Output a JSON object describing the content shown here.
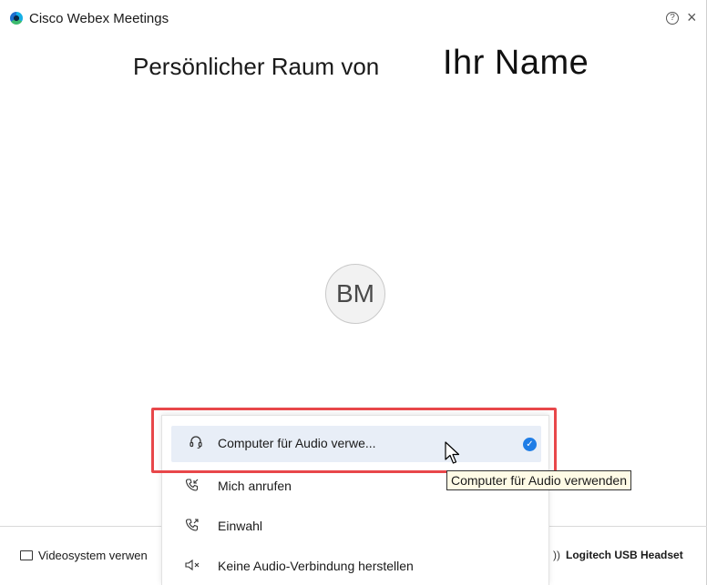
{
  "window": {
    "title": "Cisco Webex Meetings"
  },
  "room": {
    "label": "Persönlicher Raum von",
    "name": "Ihr Name"
  },
  "avatar": {
    "initials": "BM"
  },
  "audio_menu": {
    "items": [
      {
        "label": "Computer für Audio verwe...",
        "icon": "headset-icon",
        "selected": true
      },
      {
        "label": "Mich anrufen",
        "icon": "call-me-icon",
        "selected": false
      },
      {
        "label": "Einwahl",
        "icon": "dial-in-icon",
        "selected": false
      },
      {
        "label": "Keine Audio-Verbindung herstellen",
        "icon": "no-audio-icon",
        "selected": false
      }
    ]
  },
  "tooltip": {
    "text": "Computer für Audio verwenden"
  },
  "bottom_bar": {
    "video_system": "Videosystem verwen",
    "audio_device": "Logitech USB Headset"
  },
  "colors": {
    "accent": "#1f7de6",
    "selected_bg": "#e8eef7",
    "highlight": "#e8474a",
    "tooltip_bg": "#fffbe6"
  }
}
